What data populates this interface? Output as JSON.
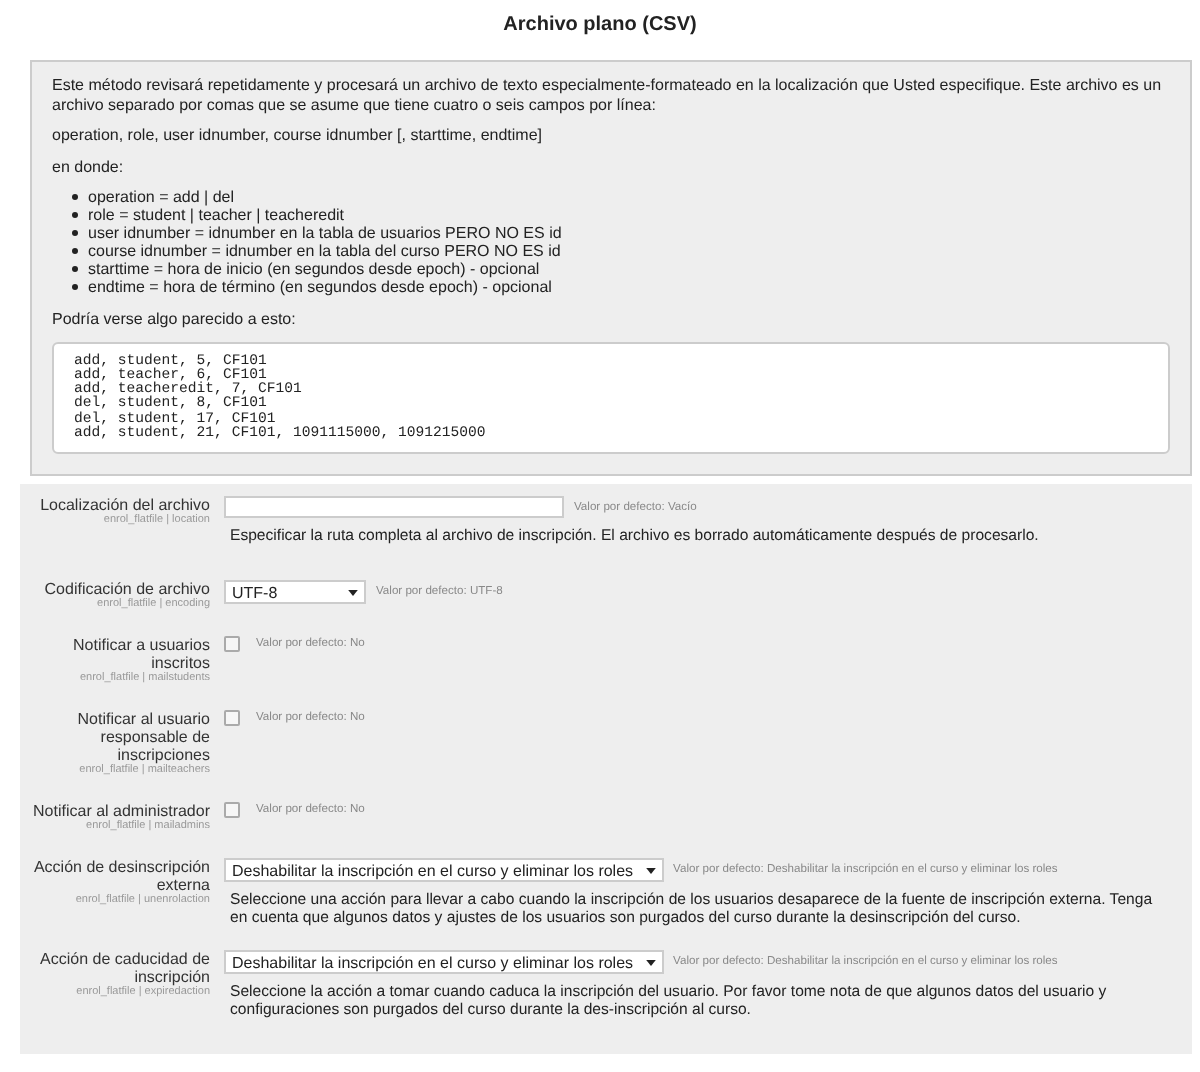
{
  "title": "Archivo plano (CSV)",
  "intro": {
    "paragraph": "Este método revisará repetidamente y procesará un archivo de texto especialmente-formateado en la localización que Usted especifique. Este archivo es un archivo separado por comas que se asume que tiene cuatro o seis campos por línea:",
    "format": "operation, role, user idnumber, course idnumber [, starttime, endtime]",
    "where": "en donde:",
    "items": [
      "operation = add | del",
      "role = student | teacher | teacheredit",
      "user idnumber = idnumber en la tabla de usuarios PERO NO ES id",
      "course idnumber = idnumber en la tabla del curso PERO NO ES id",
      "starttime = hora de inicio (en segundos desde epoch) - opcional",
      "endtime = hora de término (en segundos desde epoch) - opcional"
    ],
    "example_label": "Podría verse algo parecido a esto:",
    "code_lines": [
      "add, student, 5, CF101",
      "add, teacher, 6, CF101",
      "add, teacheredit, 7, CF101",
      "del, student, 8, CF101",
      "del, student, 17, CF101",
      "add, student, 21, CF101, 1091115000, 1091215000"
    ]
  },
  "settings": [
    {
      "kind": "text",
      "label": "Localización del archivo",
      "sublabel": "enrol_flatfile | location",
      "default": "Valor por defecto: Vacío",
      "description": "Especificar la ruta completa al archivo de inscripción. El archivo es borrado automáticamente después de procesarlo."
    },
    {
      "kind": "select",
      "label": "Codificación de archivo",
      "sublabel": "enrol_flatfile | encoding",
      "value": "UTF-8",
      "default": "Valor por defecto: UTF-8"
    },
    {
      "kind": "checkbox",
      "label": "Notificar a usuarios inscritos",
      "sublabel": "enrol_flatfile | mailstudents",
      "checked": false,
      "default": "Valor por defecto: No"
    },
    {
      "kind": "checkbox",
      "label": "Notificar al usuario responsable de inscripciones",
      "sublabel": "enrol_flatfile | mailteachers",
      "checked": false,
      "default": "Valor por defecto: No"
    },
    {
      "kind": "checkbox",
      "label": "Notificar al administrador",
      "sublabel": "enrol_flatfile | mailadmins",
      "checked": false,
      "default": "Valor por defecto: No"
    },
    {
      "kind": "select",
      "label": "Acción de desinscripción externa",
      "sublabel": "enrol_flatfile | unenrolaction",
      "value": "Deshabilitar la inscripción en el curso y eliminar los roles",
      "default": "Valor por defecto: Deshabilitar la inscripción en el curso y eliminar los roles",
      "description": "Seleccione una acción para llevar a cabo cuando la inscripción de los usuarios desaparece de la fuente de inscripción externa. Tenga en cuenta que algunos datos y ajustes de los usuarios son purgados del curso durante la desinscripción del curso."
    },
    {
      "kind": "select",
      "label": "Acción de caducidad de inscripción",
      "sublabel": "enrol_flatfile | expiredaction",
      "value": "Deshabilitar la inscripción en el curso y eliminar los roles",
      "default": "Valor por defecto: Deshabilitar la inscripción en el curso y eliminar los roles",
      "description": "Seleccione la acción a tomar cuando caduca la inscripción del usuario. Por favor tome nota de que algunos datos del usuario y configuraciones son purgados del curso durante la des-inscripción al curso."
    }
  ]
}
